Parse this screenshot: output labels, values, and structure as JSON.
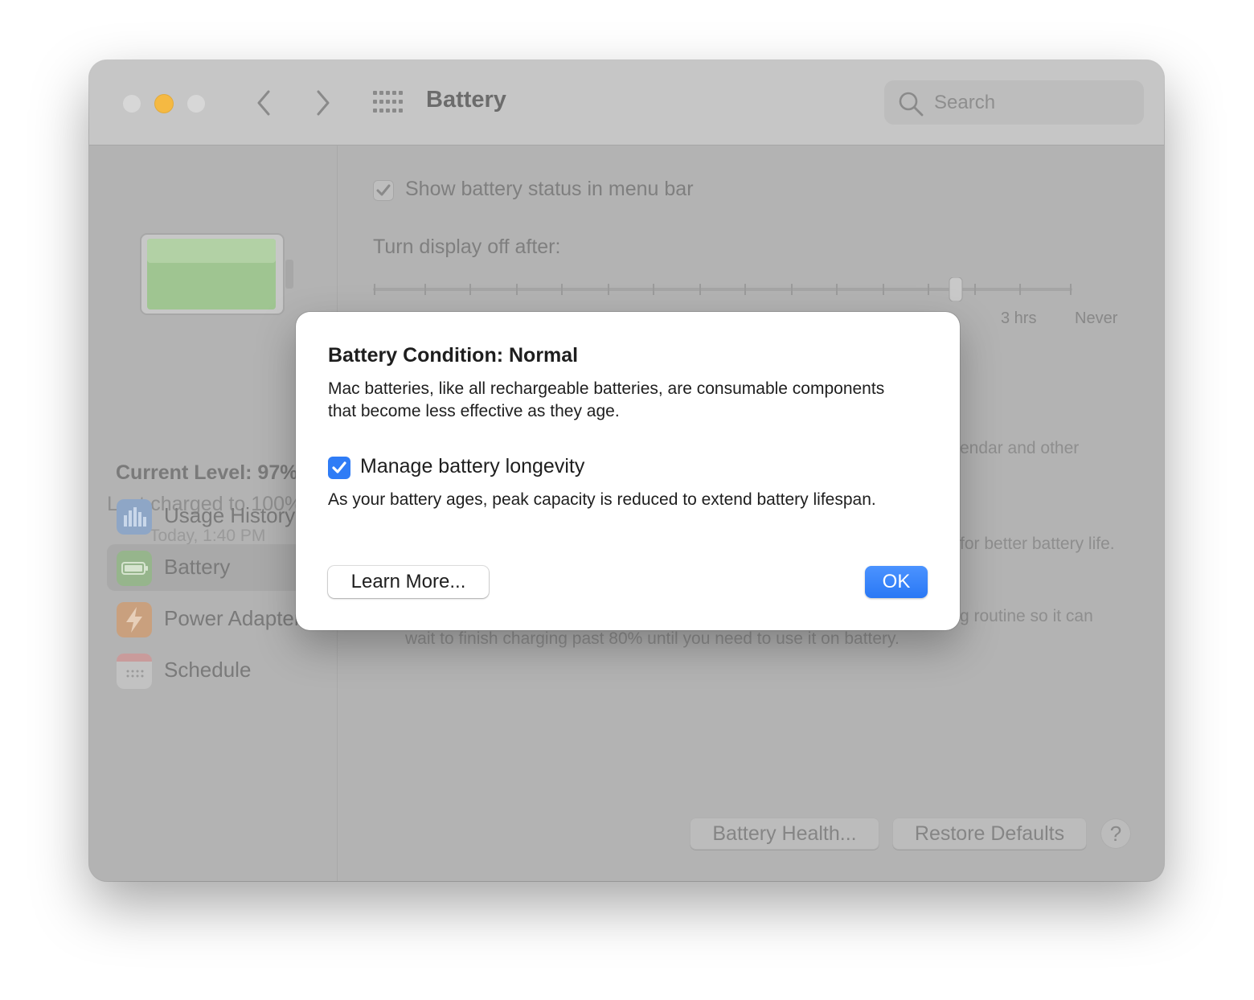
{
  "window": {
    "title": "Battery",
    "search_placeholder": "Search"
  },
  "sidebar": {
    "current_level": "Current Level: 97%",
    "last_charged": "Last charged to 100%",
    "last_charged_time": "Today, 1:40 PM",
    "items": [
      {
        "label": "Usage History",
        "icon": "bar-chart-icon"
      },
      {
        "label": "Battery",
        "icon": "battery-icon",
        "selected": true
      },
      {
        "label": "Power Adapter",
        "icon": "lightning-icon"
      },
      {
        "label": "Schedule",
        "icon": "calendar-icon"
      }
    ]
  },
  "content": {
    "show_status_label": "Show battery status in menu bar",
    "show_status_checked": true,
    "turn_off_label": "Turn display off after:",
    "slider_labels": [
      "3 hrs",
      "Never"
    ],
    "partial_texts": [
      "endar and other",
      "for better battery life.",
      "g routine so it can",
      "wait to finish charging past 80% until you need to use it on battery."
    ],
    "battery_health_button": "Battery Health...",
    "restore_defaults_button": "Restore Defaults",
    "help_button": "?"
  },
  "dialog": {
    "title": "Battery Condition: Normal",
    "body": "Mac batteries, like all rechargeable batteries, are consumable components that become less effective as they age.",
    "checkbox_label": "Manage battery longevity",
    "checkbox_checked": true,
    "checkbox_description": "As your battery ages, peak capacity is reduced to extend battery lifespan.",
    "learn_more_button": "Learn More...",
    "ok_button": "OK"
  },
  "colors": {
    "accent": "#2f7cf6",
    "minimize": "#f5b942",
    "battery_fill": "#9fc591"
  }
}
